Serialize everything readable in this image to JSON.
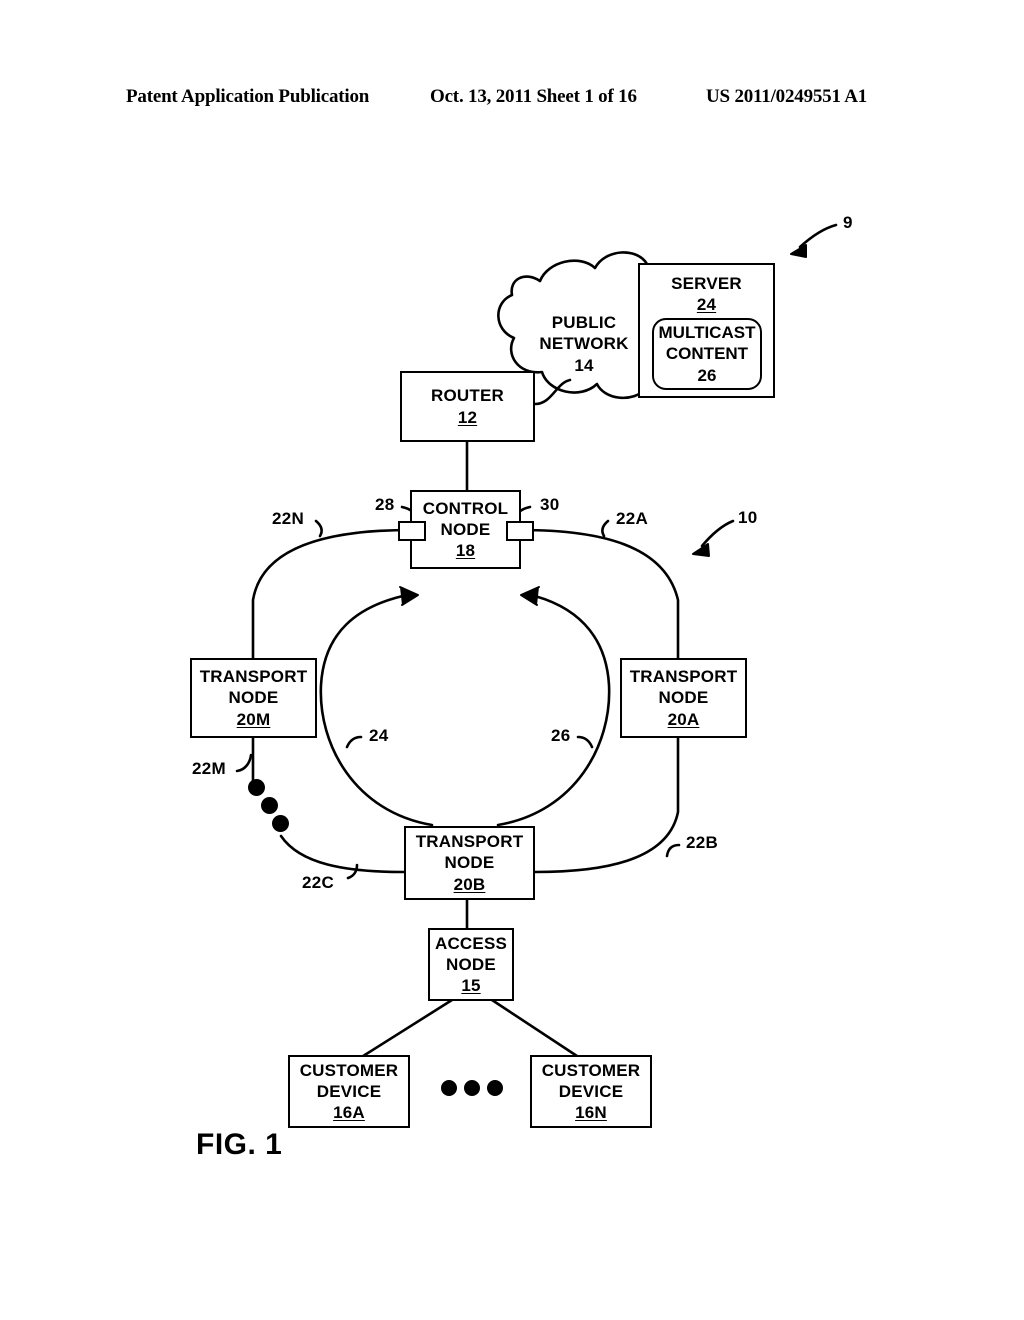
{
  "header": {
    "left": "Patent Application Publication",
    "middle": "Oct. 13, 2011  Sheet 1 of 16",
    "right": "US 2011/0249551 A1"
  },
  "figure": {
    "caption": "FIG. 1",
    "system_ref": "9",
    "ring_ref": "10"
  },
  "nodes": {
    "router": {
      "line1": "ROUTER",
      "ref": "12"
    },
    "server": {
      "line1": "SERVER",
      "ref": "24"
    },
    "multicast_content": {
      "line1": "MULTICAST",
      "line2": "CONTENT",
      "ref": "26"
    },
    "public_network": {
      "line1": "PUBLIC",
      "line2": "NETWORK",
      "ref": "14"
    },
    "control_node": {
      "line1": "CONTROL",
      "line2": "NODE",
      "ref": "18"
    },
    "transport_node_m": {
      "line1": "TRANSPORT",
      "line2": "NODE",
      "ref": "20M"
    },
    "transport_node_a": {
      "line1": "TRANSPORT",
      "line2": "NODE",
      "ref": "20A"
    },
    "transport_node_b": {
      "line1": "TRANSPORT",
      "line2": "NODE",
      "ref": "20B"
    },
    "access_node": {
      "line1": "ACCESS",
      "line2": "NODE",
      "ref": "15"
    },
    "customer_device_a": {
      "line1": "CUSTOMER",
      "line2": "DEVICE",
      "ref": "16A"
    },
    "customer_device_n": {
      "line1": "CUSTOMER",
      "line2": "DEVICE",
      "ref": "16N"
    }
  },
  "callouts": {
    "port_left": "28",
    "port_right": "30",
    "link_22n": "22N",
    "link_22a": "22A",
    "link_22m": "22M",
    "link_22b": "22B",
    "link_22c": "22C",
    "ring_24": "24",
    "ring_26": "26"
  },
  "colors": {
    "ink": "#000000",
    "paper": "#ffffff"
  }
}
